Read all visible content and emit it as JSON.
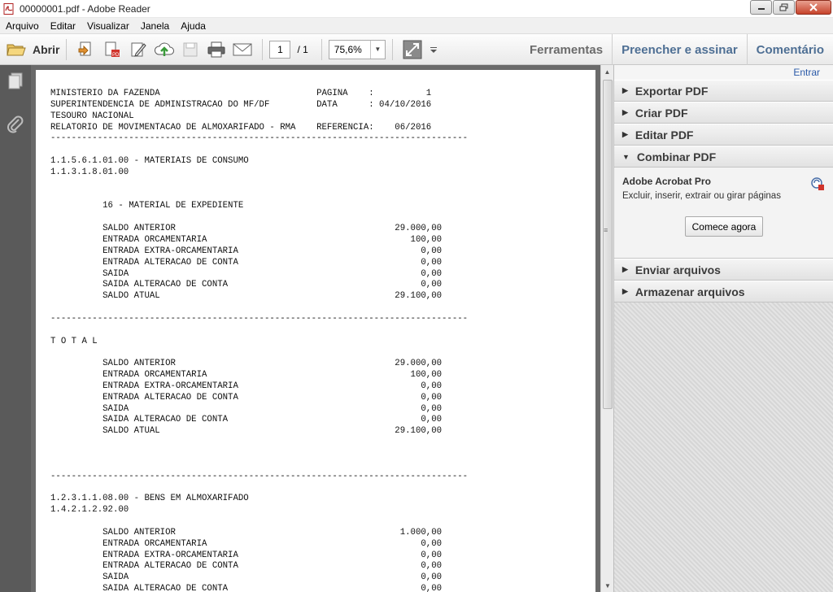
{
  "window": {
    "title": "00000001.pdf - Adobe Reader",
    "controls": [
      "minimize",
      "maximize",
      "close"
    ]
  },
  "menu": [
    "Arquivo",
    "Editar",
    "Visualizar",
    "Janela",
    "Ajuda"
  ],
  "toolbar": {
    "open_label": "Abrir",
    "page_current": "1",
    "page_total": "/ 1",
    "zoom": "75,6%",
    "right_links": {
      "tools": "Ferramentas",
      "fill_sign": "Preencher e assinar",
      "comment": "Comentário"
    }
  },
  "document": {
    "lines": [
      "MINISTERIO DA FAZENDA                              PAGINA    :          1",
      "SUPERINTENDENCIA DE ADMINISTRACAO DO MF/DF         DATA      : 04/10/2016",
      "TESOURO NACIONAL",
      "RELATORIO DE MOVIMENTACAO DE ALMOXARIFADO - RMA    REFERENCIA:    06/2016",
      "--------------------------------------------------------------------------------",
      "",
      "1.1.5.6.1.01.00 - MATERIAIS DE CONSUMO",
      "1.1.3.1.8.01.00",
      "",
      "",
      "          16 - MATERIAL DE EXPEDIENTE",
      "",
      "          SALDO ANTERIOR                                          29.000,00",
      "          ENTRADA ORCAMENTARIA                                       100,00",
      "          ENTRADA EXTRA-ORCAMENTARIA                                   0,00",
      "          ENTRADA ALTERACAO DE CONTA                                   0,00",
      "          SAIDA                                                        0,00",
      "          SAIDA ALTERACAO DE CONTA                                     0,00",
      "          SALDO ATUAL                                             29.100,00",
      "",
      "--------------------------------------------------------------------------------",
      "",
      "T O T A L",
      "",
      "          SALDO ANTERIOR                                          29.000,00",
      "          ENTRADA ORCAMENTARIA                                       100,00",
      "          ENTRADA EXTRA-ORCAMENTARIA                                   0,00",
      "          ENTRADA ALTERACAO DE CONTA                                   0,00",
      "          SAIDA                                                        0,00",
      "          SAIDA ALTERACAO DE CONTA                                     0,00",
      "          SALDO ATUAL                                             29.100,00",
      "",
      "",
      "",
      "--------------------------------------------------------------------------------",
      "",
      "1.2.3.1.1.08.00 - BENS EM ALMOXARIFADO",
      "1.4.2.1.2.92.00",
      "",
      "          SALDO ANTERIOR                                           1.000,00",
      "          ENTRADA ORCAMENTARIA                                         0,00",
      "          ENTRADA EXTRA-ORCAMENTARIA                                   0,00",
      "          ENTRADA ALTERACAO DE CONTA                                   0,00",
      "          SAIDA                                                        0,00",
      "          SAIDA ALTERACAO DE CONTA                                     0,00"
    ]
  },
  "right_panel": {
    "sign_in": "Entrar",
    "sections": [
      {
        "label": "Exportar PDF",
        "expanded": false
      },
      {
        "label": "Criar PDF",
        "expanded": false
      },
      {
        "label": "Editar PDF",
        "expanded": false
      },
      {
        "label": "Combinar PDF",
        "expanded": true
      }
    ],
    "combine": {
      "product": "Adobe Acrobat Pro",
      "description": "Excluir, inserir, extrair ou girar páginas",
      "button": "Comece agora"
    },
    "sections_after": [
      {
        "label": "Enviar arquivos",
        "expanded": false
      },
      {
        "label": "Armazenar arquivos",
        "expanded": false
      }
    ]
  }
}
